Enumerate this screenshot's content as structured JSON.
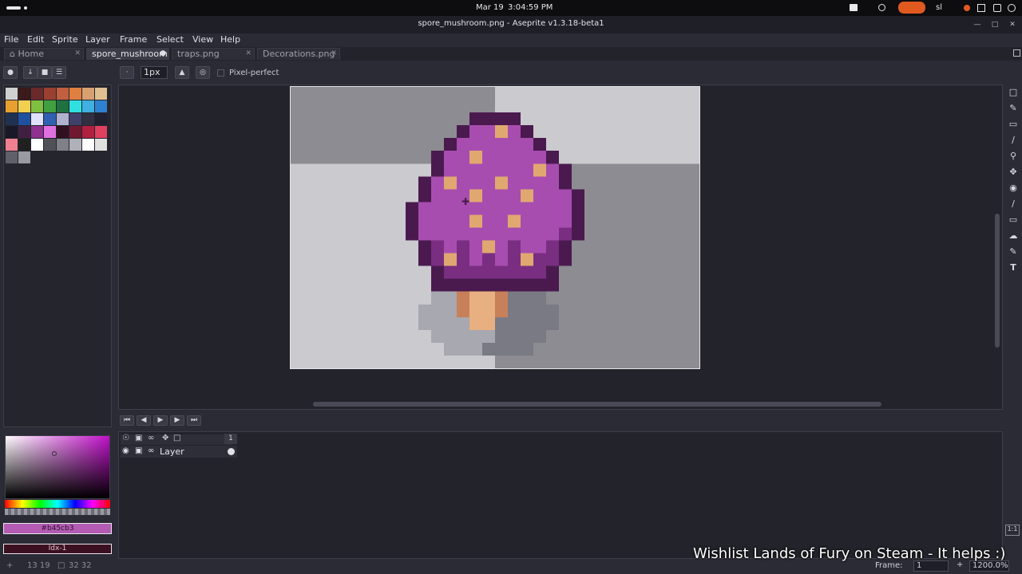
{
  "os": {
    "date": "Mar 19",
    "time": "3:04:59 PM",
    "user": "sl"
  },
  "window": {
    "title": "spore_mushroom.png - Aseprite v1.3.18-beta1"
  },
  "menu": [
    "File",
    "Edit",
    "Sprite",
    "Layer",
    "Frame",
    "Select",
    "View",
    "Help"
  ],
  "tabs": [
    {
      "label": "Home",
      "active": false
    },
    {
      "label": "spore_mushroom",
      "active": true
    },
    {
      "label": "traps.png",
      "active": false
    },
    {
      "label": "Decorations.png",
      "active": false
    }
  ],
  "toolbar": {
    "brush_size": "1px",
    "pixel_perfect_label": "Pixel-perfect"
  },
  "palette": {
    "colors": [
      "#d0d0d0",
      "#3a1a1a",
      "#6a2a2a",
      "#9a4030",
      "#c06040",
      "#e08040",
      "#d8a070",
      "#e0c090",
      "#e8a030",
      "#f0d050",
      "#80c040",
      "#40a040",
      "#207040",
      "#30e0e0",
      "#40b0e0",
      "#3080d0",
      "#203050",
      "#2050a0",
      "#e0e0ff",
      "#3060b0",
      "#b0b0d0",
      "#40406a",
      "#303040",
      "#202030",
      "#181828",
      "#402040",
      "#903090",
      "#e070e0",
      "#301020",
      "#701830",
      "#b02040",
      "#e04060",
      "#f08090",
      "#202020",
      "#ffffff",
      "#505058",
      "#808088",
      "#b0b0b8",
      "#ffffff",
      "#e0e0e0",
      "#606068",
      "#9a9aa2"
    ]
  },
  "color": {
    "hex": "#b45cb3",
    "index": "Idx-1",
    "accent": "#b45cb3"
  },
  "timeline": {
    "frame_header": "1",
    "layers": [
      {
        "name": "Layer"
      }
    ]
  },
  "status": {
    "cursor": "13 19",
    "size": "32 32",
    "frame_label": "Frame:",
    "frame_value": "1",
    "zoom": "1200.0%"
  },
  "overlay": {
    "text": "Wishlist Lands of Fury on Steam - It helps :)"
  },
  "sprite": {
    "grid_w": 32,
    "grid_h": 22,
    "legend": {
      ".": "transparent",
      "D": "#4a1a4e",
      "M": "#a84db0",
      "K": "#7a2e82",
      "S": "#e0a870",
      "C": "#c8805a",
      "F": "#e8b080",
      "G": "#a8a8b0",
      "H": "#7a7a84"
    },
    "rows": [
      "................................",
      "................................",
      "..............DDDD..............",
      ".............DMMSMD.............",
      "............DMMMMMMD............",
      "...........DMMSMMMMMD...........",
      "...........DMMMMMMMSMD..........",
      "..........DMSMMMSMMMMD..........",
      "..........DMMMSMMMSMMMD.........",
      ".........DMMMMMMMMMMMMD.........",
      ".........DMMMMSMMSMMMMD.........",
      ".........DMMMMMMMMMMMKD.........",
      "..........DKMKMSMKMMKD..........",
      "..........DKSKMKMKSKKD..........",
      "...........DKKKKKKKKD...........",
      "...........DDDDDDDDDD...........",
      "...........GGCFFCHHH............",
      "..........GGGCFFCHHHH...........",
      "..........GGGGFFHHHHH...........",
      "...........GGGGGHHHH............",
      "............GGGHHHH.............",
      "................................"
    ]
  }
}
